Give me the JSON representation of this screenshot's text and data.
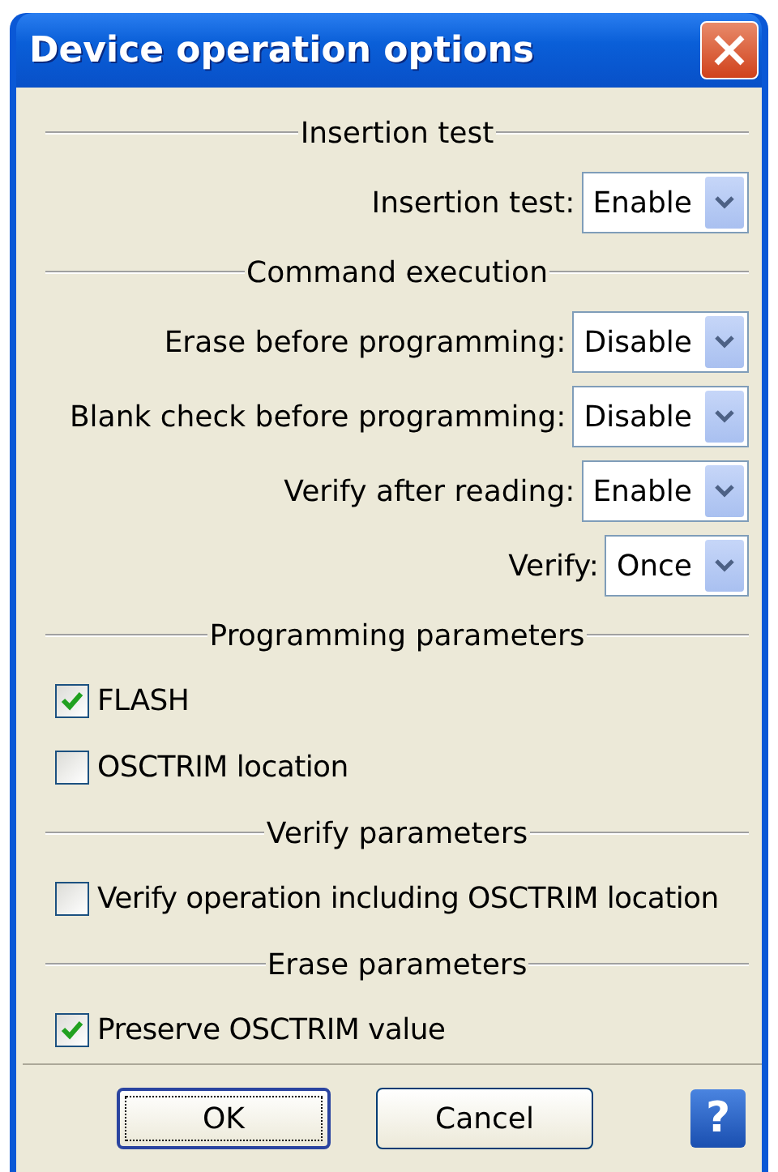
{
  "window": {
    "title": "Device operation options"
  },
  "rows": [
    {
      "kind": "section",
      "label": "Insertion test"
    },
    {
      "kind": "select",
      "label": "Insertion test:",
      "value": "Enable"
    },
    {
      "kind": "section",
      "label": "Command execution"
    },
    {
      "kind": "select",
      "label": "Erase before programming:",
      "value": "Disable"
    },
    {
      "kind": "select",
      "label": "Blank check before programming:",
      "value": "Disable"
    },
    {
      "kind": "select",
      "label": "Verify after reading:",
      "value": "Enable"
    },
    {
      "kind": "select",
      "label": "Verify:",
      "value": "Once"
    },
    {
      "kind": "section",
      "label": "Programming parameters"
    },
    {
      "kind": "checkbox",
      "label": "FLASH",
      "checked": true
    },
    {
      "kind": "checkbox",
      "label": "OSCTRIM location",
      "checked": false
    },
    {
      "kind": "section",
      "label": "Verify parameters"
    },
    {
      "kind": "checkbox",
      "label": "Verify operation including OSCTRIM location",
      "checked": false
    },
    {
      "kind": "section",
      "label": "Erase parameters"
    },
    {
      "kind": "checkbox",
      "label": "Preserve OSCTRIM value",
      "checked": true
    }
  ],
  "buttons": [
    {
      "label": "OK",
      "default": true
    },
    {
      "label": "Cancel",
      "default": false
    }
  ],
  "help_button": {
    "label": "?"
  }
}
